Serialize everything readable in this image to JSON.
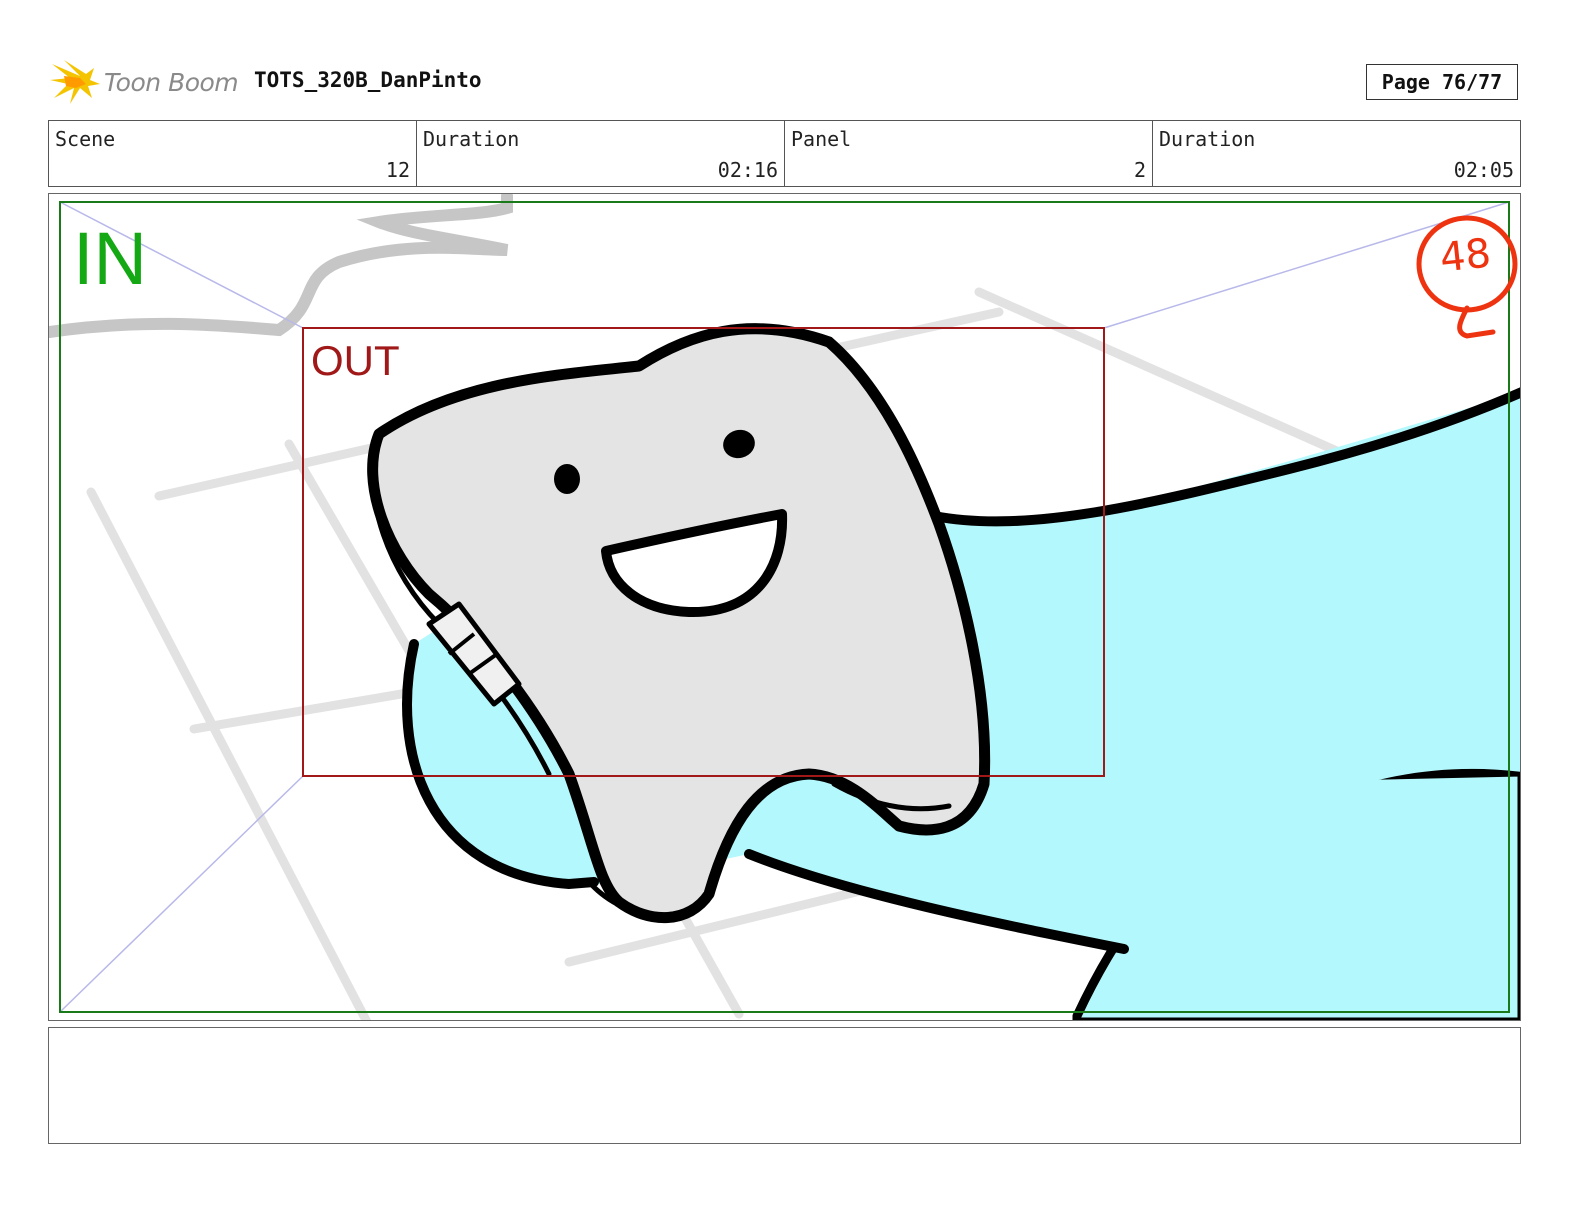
{
  "header": {
    "logo_text": "Toon Boom",
    "project_title": "TOTS_320B_DanPinto",
    "page_label": "Page 76/77"
  },
  "info": {
    "scene_label": "Scene",
    "scene_value": "12",
    "scene_duration_label": "Duration",
    "scene_duration_value": "02:16",
    "panel_label": "Panel",
    "panel_value": "2",
    "panel_duration_label": "Duration",
    "panel_duration_value": "02:05"
  },
  "panel": {
    "in_label": "IN",
    "out_label": "OUT",
    "frame_number": "48",
    "colors": {
      "in_frame": "#1a7a1a",
      "in_text": "#14a814",
      "out_frame": "#a01818",
      "mark": "#ee3311",
      "pillow": "#b3f8fc",
      "tooth": "#e4e4e4"
    }
  },
  "notes": {
    "text": ""
  }
}
